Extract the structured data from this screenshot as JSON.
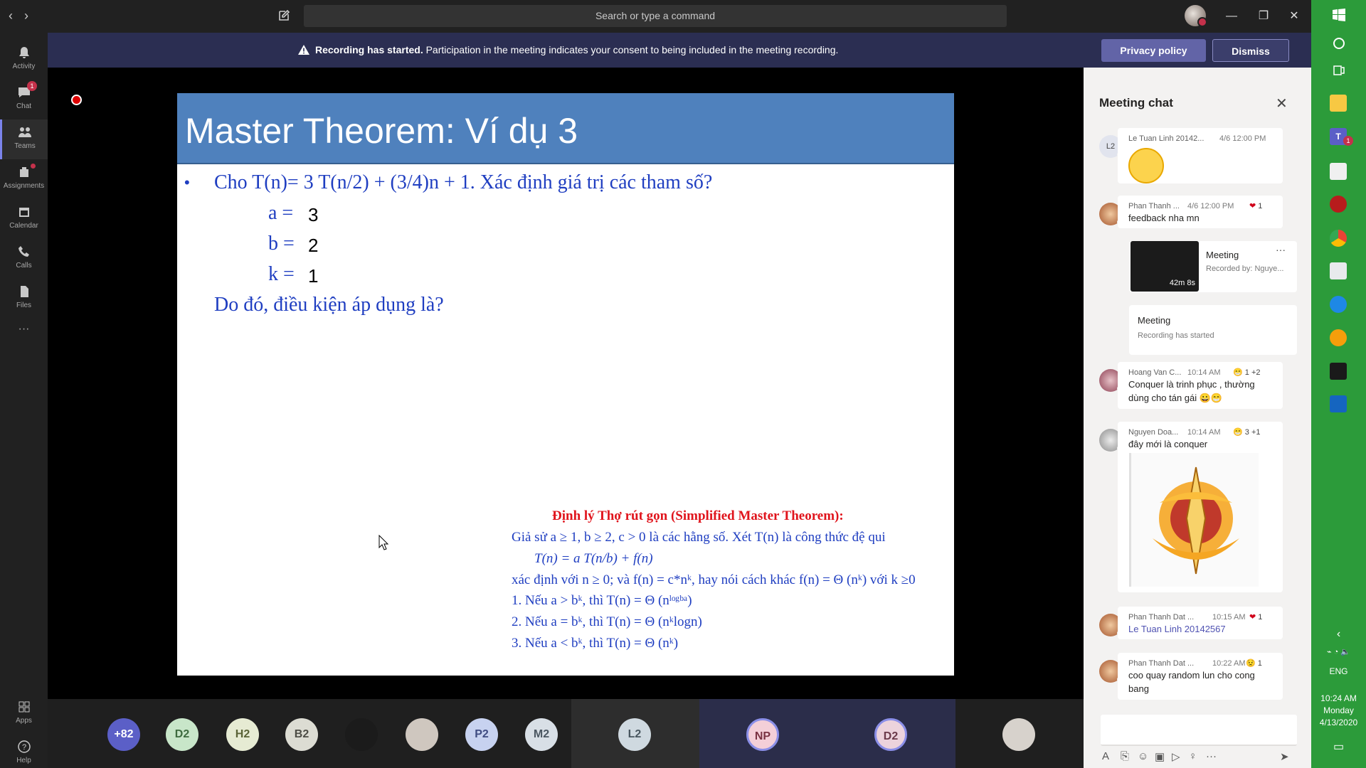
{
  "rail": {
    "items": [
      {
        "label": "Activity",
        "icon": "bell-icon"
      },
      {
        "label": "Chat",
        "icon": "chat-icon",
        "badge": "1"
      },
      {
        "label": "Teams",
        "icon": "teams-icon"
      },
      {
        "label": "Assignments",
        "icon": "assignments-icon"
      },
      {
        "label": "Calendar",
        "icon": "calendar-icon"
      },
      {
        "label": "Calls",
        "icon": "phone-icon"
      },
      {
        "label": "Files",
        "icon": "file-icon"
      },
      {
        "label": "···",
        "icon": "more-icon"
      }
    ],
    "bottom": [
      {
        "label": "Apps",
        "icon": "apps-icon"
      },
      {
        "label": "Help",
        "icon": "help-icon"
      }
    ]
  },
  "topbar": {
    "back": "‹",
    "forward": "›",
    "search_placeholder": "Search or type a command",
    "minimize": "—",
    "maximize": "❐",
    "close": "✕"
  },
  "banner": {
    "title": "Recording has started.",
    "text": "Participation in the meeting indicates your consent to being included in the meeting recording.",
    "privacy_button": "Privacy policy",
    "dismiss_button": "Dismiss"
  },
  "slide": {
    "title": "Master Theorem: Ví dụ 3",
    "bullet": "•",
    "question": "Cho T(n)= 3 T(n/2) + (3/4)n + 1. Xác định giá trị các tham số?",
    "params": [
      {
        "name": "a =",
        "value": "3"
      },
      {
        "name": "b =",
        "value": "2"
      },
      {
        "name": "k =",
        "value": "1"
      }
    ],
    "condition": "Do đó, điều kiện áp dụng là?",
    "theorem_title": "Định lý Thợ rút gọn (Simplified Master Theorem):",
    "theorem_lines": [
      "Giả sử a ≥ 1, b ≥ 2, c > 0 là các hằng số. Xét T(n) là công thức đệ qui",
      "T(n) = a T(n/b) + f(n)",
      "xác định với n ≥ 0; và f(n) = c*nᵏ, hay nói cách khác f(n) = Θ (nᵏ) với k ≥0",
      "1. Nếu a > bᵏ, thì  T(n)  = Θ (nˡᵒᵍᵇᵃ)",
      "2. Nếu a = bᵏ, thì  T(n)  = Θ (nᵏlogn)",
      "3. Nếu a < bᵏ, thì  T(n)  = Θ (nᵏ)"
    ]
  },
  "participants": [
    {
      "label": "+82",
      "bg": "#5b5fc7",
      "fg": "#ffffff"
    },
    {
      "label": "D2",
      "bg": "#c8e6c9",
      "fg": "#3e6b3f"
    },
    {
      "label": "H2",
      "bg": "#e6ebd3",
      "fg": "#5a6337"
    },
    {
      "label": "B2",
      "bg": "#dcdcd3",
      "fg": "#4d4d46"
    },
    {
      "label": "",
      "bg": "#1b1b1b",
      "fg": "#ffffff"
    },
    {
      "label": "",
      "bg": "#cfc7bf",
      "fg": "#ffffff"
    },
    {
      "label": "P2",
      "bg": "#c7d2f0",
      "fg": "#3f4c82"
    },
    {
      "label": "M2",
      "bg": "#d8dfe6",
      "fg": "#4a5661"
    },
    {
      "label": "L2",
      "bg": "#cfd9e0",
      "fg": "#48565f"
    },
    {
      "label": "NP",
      "bg": "#f4cfd8",
      "fg": "#7a3343"
    },
    {
      "label": "D2",
      "bg": "#ecd3dc",
      "fg": "#6b3a4a"
    },
    {
      "label": "",
      "bg": "#d7d2cc",
      "fg": "#ffffff"
    }
  ],
  "chat": {
    "title": "Meeting chat",
    "messages": [
      {
        "avatar": "L2",
        "name": "Le Tuan Linh 20142...",
        "time": "4/6 12:00 PM",
        "text": ""
      },
      {
        "avatar": "",
        "name": "Phan Thanh ...",
        "time": "4/6 12:00 PM",
        "reaction": "1",
        "text": "feedback nha mn"
      },
      {
        "avatar": "",
        "name": "Hoang Van C...",
        "time": "10:14 AM",
        "reaction": "1",
        "more": "+2",
        "text": "Conquer là trinh phục , thường dùng cho tán gái 😀😁"
      },
      {
        "avatar": "",
        "name": "Nguyen Doa...",
        "time": "10:14 AM",
        "reaction": "3",
        "more": "+1",
        "text": "đây mới là conquer"
      },
      {
        "avatar": "",
        "name": "Phan Thanh Dat ...",
        "time": "10:15 AM",
        "reaction": "1",
        "text": "Le Tuan Linh 20142567"
      },
      {
        "avatar": "",
        "name": "Phan Thanh Dat ...",
        "time": "10:22 AM",
        "reaction": "1",
        "text": "coo quay random lun cho cong bang"
      }
    ],
    "meeting_card": {
      "title": "Meeting",
      "subtitle": "Recorded by: Nguye...",
      "duration": "42m 8s",
      "more": "···"
    },
    "meeting_started": {
      "title": "Meeting",
      "subtitle": "Recording has started"
    }
  },
  "taskbar": {
    "lang": "ENG",
    "time": "10:24 AM",
    "day": "Monday",
    "date": "4/13/2020",
    "teams_badge": "1"
  }
}
